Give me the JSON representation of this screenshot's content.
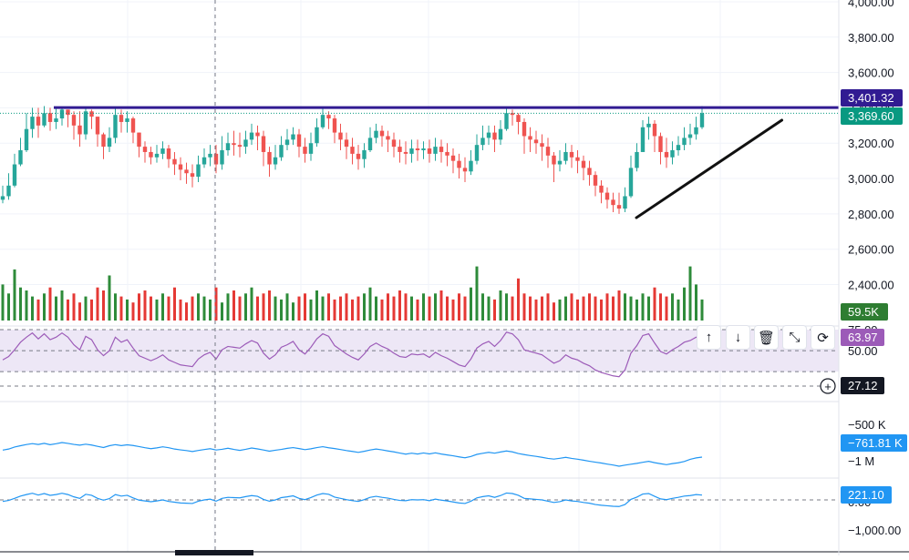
{
  "chart_data": {
    "type": "candlestick",
    "price_axis": {
      "ticks": [
        "4,000.00",
        "3,800.00",
        "3,600.00",
        "3,400.00",
        "3,200.00",
        "3,000.00",
        "2,800.00",
        "2,600.00",
        "2,400.00"
      ],
      "tick_values": [
        4000,
        3800,
        3600,
        3400,
        3200,
        3000,
        2800,
        2600,
        2400
      ],
      "range": [
        2310,
        4010
      ]
    },
    "closes": [
      2900,
      2960,
      3080,
      3160,
      3280,
      3350,
      3300,
      3370,
      3320,
      3340,
      3390,
      3360,
      3300,
      3250,
      3380,
      3350,
      3250,
      3180,
      3230,
      3360,
      3320,
      3340,
      3260,
      3180,
      3150,
      3120,
      3140,
      3170,
      3110,
      3080,
      3050,
      3030,
      3010,
      3080,
      3120,
      3140,
      3080,
      3160,
      3200,
      3190,
      3180,
      3220,
      3260,
      3240,
      3150,
      3080,
      3120,
      3190,
      3220,
      3250,
      3180,
      3140,
      3200,
      3290,
      3360,
      3340,
      3260,
      3220,
      3180,
      3140,
      3110,
      3160,
      3230,
      3270,
      3240,
      3220,
      3180,
      3150,
      3140,
      3170,
      3160,
      3170,
      3140,
      3180,
      3150,
      3130,
      3100,
      3060,
      3040,
      3100,
      3190,
      3230,
      3260,
      3220,
      3280,
      3370,
      3360,
      3320,
      3240,
      3220,
      3200,
      3180,
      3130,
      3080,
      3100,
      3150,
      3120,
      3100,
      3060,
      3020,
      2960,
      2920,
      2880,
      2850,
      2830,
      2900,
      3060,
      3150,
      3290,
      3310,
      3240,
      3150,
      3120,
      3160,
      3190,
      3230,
      3250,
      3290,
      3370
    ],
    "highs": [
      2960,
      3030,
      3140,
      3230,
      3370,
      3400,
      3400,
      3410,
      3400,
      3400,
      3400,
      3390,
      3380,
      3380,
      3400,
      3390,
      3330,
      3260,
      3290,
      3400,
      3390,
      3380,
      3350,
      3260,
      3210,
      3180,
      3190,
      3210,
      3190,
      3150,
      3120,
      3090,
      3080,
      3130,
      3170,
      3190,
      3190,
      3240,
      3260,
      3270,
      3260,
      3270,
      3310,
      3300,
      3270,
      3180,
      3190,
      3240,
      3280,
      3290,
      3280,
      3230,
      3260,
      3340,
      3400,
      3380,
      3360,
      3310,
      3260,
      3230,
      3190,
      3200,
      3290,
      3310,
      3300,
      3270,
      3260,
      3220,
      3210,
      3220,
      3220,
      3210,
      3220,
      3230,
      3220,
      3200,
      3170,
      3140,
      3120,
      3160,
      3250,
      3300,
      3300,
      3300,
      3330,
      3400,
      3390,
      3370,
      3340,
      3290,
      3270,
      3250,
      3230,
      3150,
      3160,
      3200,
      3190,
      3160,
      3130,
      3100,
      3040,
      2990,
      2950,
      2920,
      2920,
      2950,
      3130,
      3200,
      3330,
      3350,
      3330,
      3260,
      3230,
      3210,
      3240,
      3290,
      3310,
      3350,
      3410
    ],
    "lows": [
      2860,
      2880,
      2950,
      3070,
      3150,
      3230,
      3230,
      3290,
      3270,
      3280,
      3300,
      3290,
      3220,
      3180,
      3220,
      3280,
      3180,
      3110,
      3150,
      3200,
      3260,
      3260,
      3200,
      3120,
      3090,
      3080,
      3090,
      3110,
      3060,
      3020,
      2990,
      2970,
      2950,
      2980,
      3060,
      3070,
      3030,
      3050,
      3130,
      3130,
      3120,
      3140,
      3190,
      3160,
      3070,
      3010,
      3050,
      3100,
      3160,
      3190,
      3120,
      3090,
      3100,
      3180,
      3280,
      3280,
      3200,
      3160,
      3110,
      3080,
      3050,
      3060,
      3150,
      3200,
      3180,
      3150,
      3120,
      3090,
      3080,
      3090,
      3100,
      3110,
      3090,
      3100,
      3090,
      3070,
      3030,
      3000,
      2980,
      3020,
      3080,
      3160,
      3190,
      3150,
      3190,
      3270,
      3300,
      3250,
      3140,
      3150,
      3140,
      3100,
      3060,
      2980,
      3040,
      3080,
      3060,
      3030,
      2990,
      2960,
      2900,
      2860,
      2830,
      2810,
      2800,
      2810,
      2890,
      3040,
      3150,
      3220,
      3150,
      3080,
      3060,
      3080,
      3130,
      3160,
      3190,
      3220,
      3280
    ],
    "volumes": [
      60,
      45,
      85,
      55,
      50,
      40,
      35,
      45,
      55,
      40,
      50,
      35,
      45,
      30,
      40,
      35,
      55,
      50,
      75,
      45,
      40,
      35,
      30,
      45,
      50,
      40,
      35,
      45,
      40,
      55,
      35,
      30,
      40,
      45,
      40,
      35,
      55,
      30,
      45,
      50,
      40,
      45,
      55,
      40,
      45,
      50,
      40,
      35,
      45,
      30,
      40,
      45,
      35,
      50,
      40,
      45,
      35,
      40,
      45,
      35,
      40,
      45,
      55,
      40,
      35,
      45,
      40,
      50,
      45,
      40,
      35,
      45,
      40,
      45,
      50,
      40,
      35,
      45,
      40,
      55,
      90,
      45,
      40,
      35,
      50,
      45,
      40,
      70,
      45,
      40,
      35,
      40,
      45,
      30,
      35,
      40,
      45,
      35,
      40,
      45,
      40,
      35,
      45,
      40,
      50,
      45,
      40,
      35,
      45,
      40,
      55,
      45,
      40,
      45,
      35,
      55,
      90,
      60,
      35
    ],
    "rsi": [
      39,
      43,
      51,
      60,
      66,
      71,
      64,
      70,
      63,
      66,
      71,
      66,
      57,
      51,
      67,
      63,
      51,
      44,
      50,
      66,
      60,
      63,
      53,
      44,
      41,
      38,
      41,
      45,
      39,
      36,
      33,
      32,
      31,
      40,
      45,
      48,
      40,
      51,
      55,
      54,
      53,
      58,
      62,
      59,
      47,
      40,
      45,
      54,
      57,
      61,
      51,
      46,
      54,
      64,
      70,
      67,
      56,
      51,
      46,
      42,
      39,
      46,
      55,
      59,
      55,
      52,
      47,
      43,
      42,
      46,
      45,
      46,
      42,
      48,
      44,
      41,
      37,
      33,
      31,
      40,
      53,
      58,
      61,
      55,
      62,
      72,
      70,
      63,
      51,
      49,
      47,
      45,
      40,
      35,
      38,
      45,
      41,
      39,
      35,
      32,
      27,
      24,
      22,
      20,
      19,
      27,
      47,
      56,
      68,
      70,
      59,
      49,
      46,
      51,
      55,
      60,
      62,
      66,
      64
    ],
    "rsi_axis": {
      "ticks": [
        "75.00",
        "50.00"
      ],
      "tick_values": [
        75,
        50
      ],
      "overbought": 75,
      "oversold": 25
    },
    "obv_axis": {
      "ticks": [
        "−500 K",
        "−1 M"
      ],
      "tick_values": [
        -500000,
        -1000000
      ]
    },
    "cci_axis": {
      "ticks": [
        "0.00",
        "−1,000.00"
      ],
      "tick_values": [
        0,
        -1000
      ]
    },
    "resistance_level": 3401.32,
    "trendline": {
      "from": {
        "bar": 112,
        "price": 2830
      },
      "to": {
        "bar": 129,
        "price": 3330
      }
    },
    "last_price": 3369.6,
    "crosshair_value": 27.12
  },
  "price_tags": {
    "resistance": "3,401.32",
    "last_price": "3,369.60",
    "volume": "59.5K",
    "rsi": "63.97",
    "crosshair": "27.12",
    "obv": "−761.81 K",
    "cci": "221.10"
  },
  "toolbar": {
    "up_label": "↑",
    "down_label": "↓",
    "delete_label": "🗑",
    "collapse_label": "⤡",
    "more_label": "⟳"
  },
  "colors": {
    "up": "#26a69a",
    "down": "#ef5350",
    "vol_up": "#2e8b3a",
    "vol_down": "#e53935",
    "rsi_line": "#9c5bb8",
    "rsi_band": "#ede7f6",
    "obv_line": "#2196f3",
    "cci_line": "#2196f3",
    "resistance": "#311b92",
    "last_price": "#089981",
    "volume_tag": "#2e7d32",
    "rsi_tag": "#9c5bb8",
    "crosshair_tag": "#131722",
    "obv_tag": "#2196f3",
    "trendline": "#111111"
  }
}
